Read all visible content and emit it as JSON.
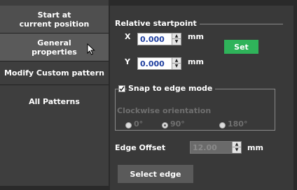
{
  "sidebar": {
    "items": [
      {
        "label": "Start at\ncurrent position"
      },
      {
        "label": "General\nproperties"
      },
      {
        "label": "Modify Custom pattern"
      },
      {
        "label": "All Patterns"
      }
    ]
  },
  "relative": {
    "title": "Relative startpoint",
    "x_label": "X",
    "x_value": "0.000",
    "y_label": "Y",
    "y_value": "0.000",
    "unit": "mm",
    "set_label": "Set"
  },
  "snap": {
    "title": "Snap to edge mode",
    "checked": true,
    "orientation_label": "Clockwise orientation",
    "options": [
      "0°",
      "90°",
      "180°"
    ],
    "selected": "90°"
  },
  "edge_offset": {
    "label": "Edge Offset",
    "value": "12.00",
    "unit": "mm"
  },
  "select_edge_label": "Select edge",
  "icons": {
    "cursor": "mouse-pointer-icon",
    "check": "check-icon",
    "spin_up": "arrow-up-icon",
    "spin_down": "arrow-down-icon"
  },
  "colors": {
    "set_button": "#2fb35a",
    "input_text": "#1f3f9f"
  }
}
